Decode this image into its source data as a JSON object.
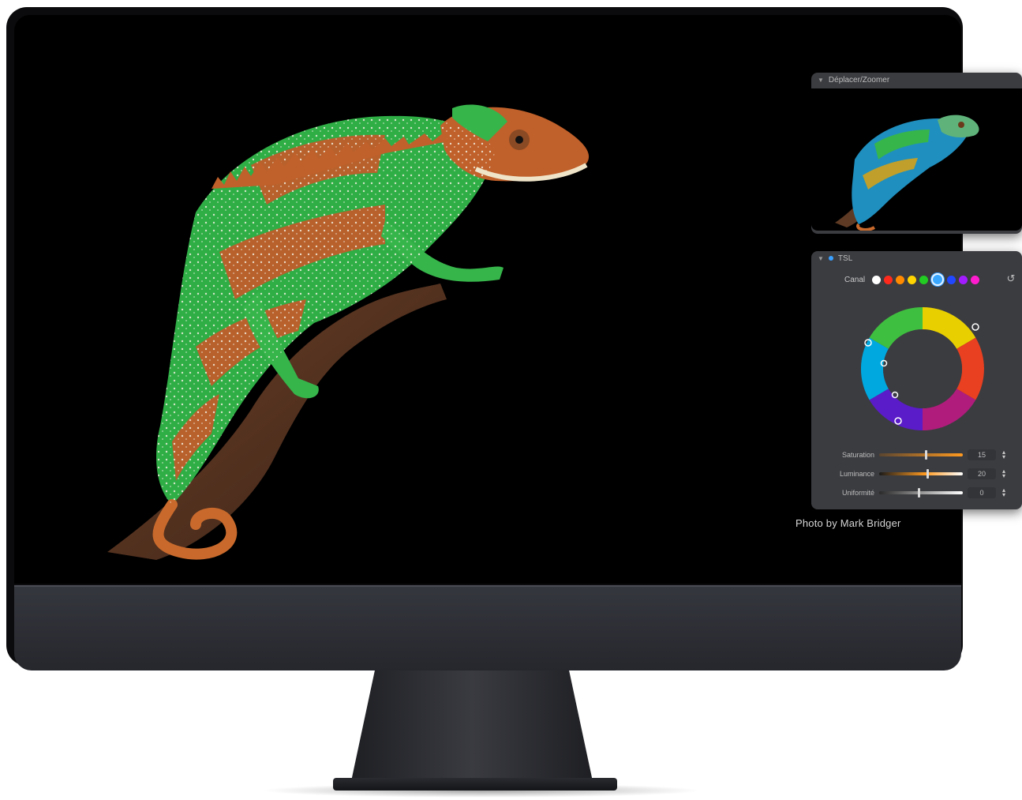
{
  "photo": {
    "credit": "Photo by Mark Bridger"
  },
  "nav_panel": {
    "title": "Déplacer/Zoomer"
  },
  "hsl_panel": {
    "title": "TSL",
    "channel_label": "Canal",
    "channels": [
      {
        "name": "white",
        "color": "#ffffff"
      },
      {
        "name": "red",
        "color": "#ff2a1c"
      },
      {
        "name": "orange",
        "color": "#ff8a00"
      },
      {
        "name": "yellow",
        "color": "#ffd400"
      },
      {
        "name": "green",
        "color": "#22cc22"
      },
      {
        "name": "cyan",
        "color": "#3aa7ff",
        "active": true
      },
      {
        "name": "blue",
        "color": "#2148ff"
      },
      {
        "name": "purple",
        "color": "#a21cff"
      },
      {
        "name": "magenta",
        "color": "#ff1ccf"
      }
    ],
    "sliders": [
      {
        "label": "Saturation",
        "value": "15",
        "level": 0.55
      },
      {
        "label": "Luminance",
        "value": "20",
        "level": 0.57
      },
      {
        "label": "Uniformité",
        "value": "0",
        "level": 0.46
      }
    ]
  }
}
